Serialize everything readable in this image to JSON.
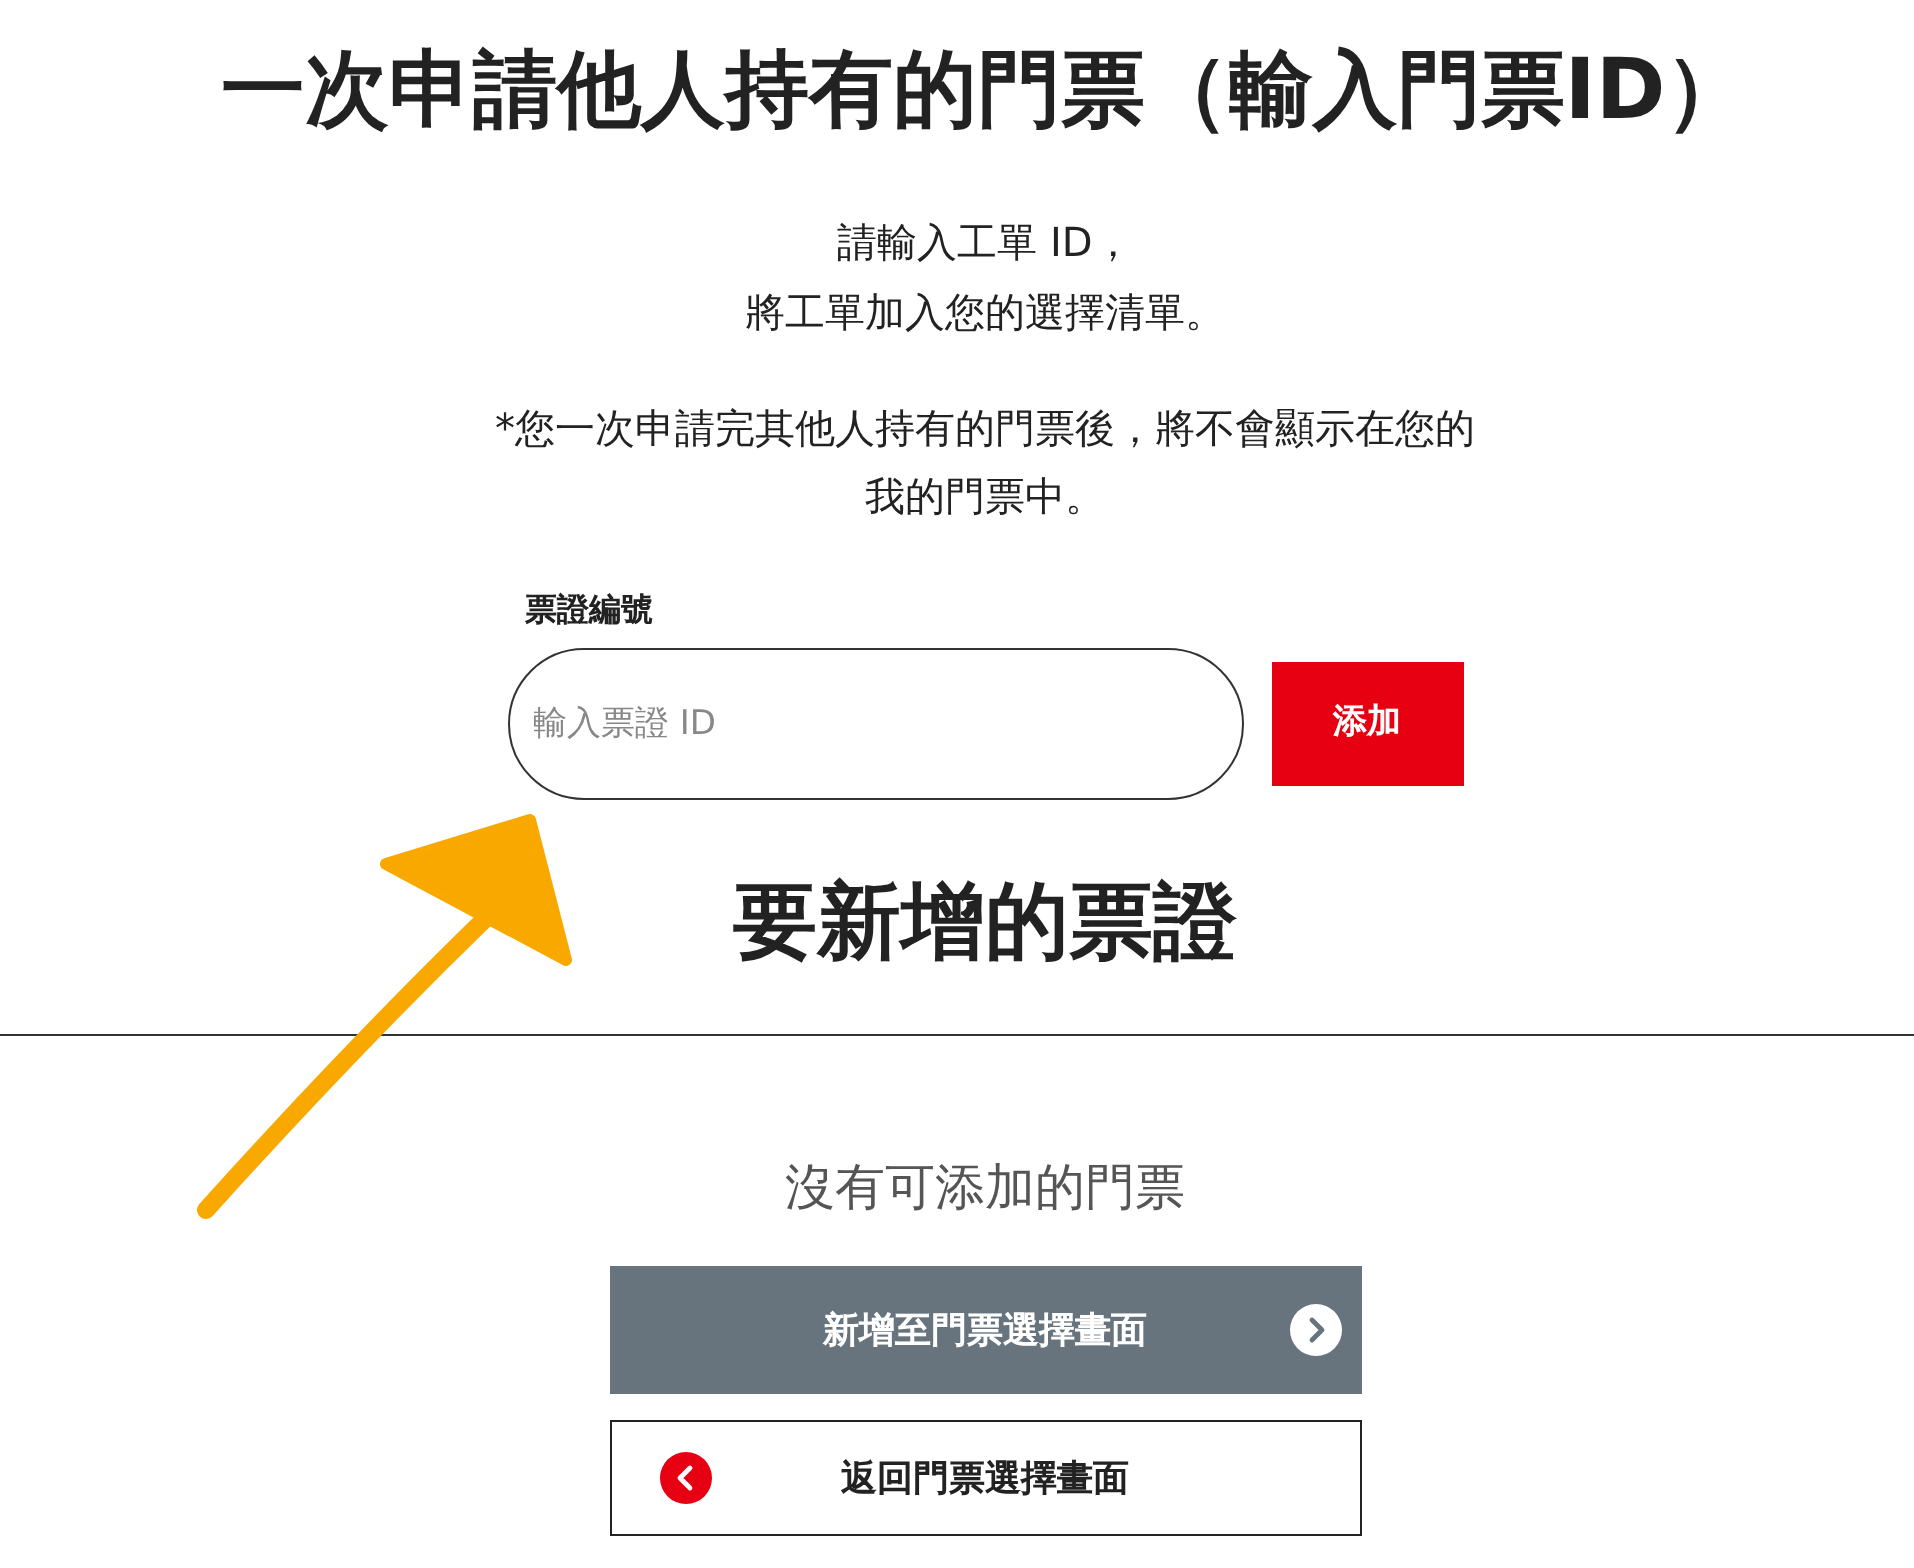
{
  "page": {
    "title": "一次申請他人持有的門票（輸入門票ID）",
    "intro": [
      "請輸入工單 ID，",
      "將工單加入您的選擇清單。"
    ],
    "note": [
      "*您一次申請完其他人持有的門票後，將不會顯示在您的",
      "我的門票中。"
    ]
  },
  "ticket_form": {
    "label": "票證編號",
    "placeholder": "輸入票證 ID",
    "add_button": "添加"
  },
  "tickets_section": {
    "heading": "要新增的票證",
    "empty_message": "沒有可添加的門票"
  },
  "actions": [
    {
      "kind": "primary",
      "label": "新增至門票選擇畫面"
    },
    {
      "kind": "back",
      "label": "返回門票選擇畫面"
    }
  ]
}
